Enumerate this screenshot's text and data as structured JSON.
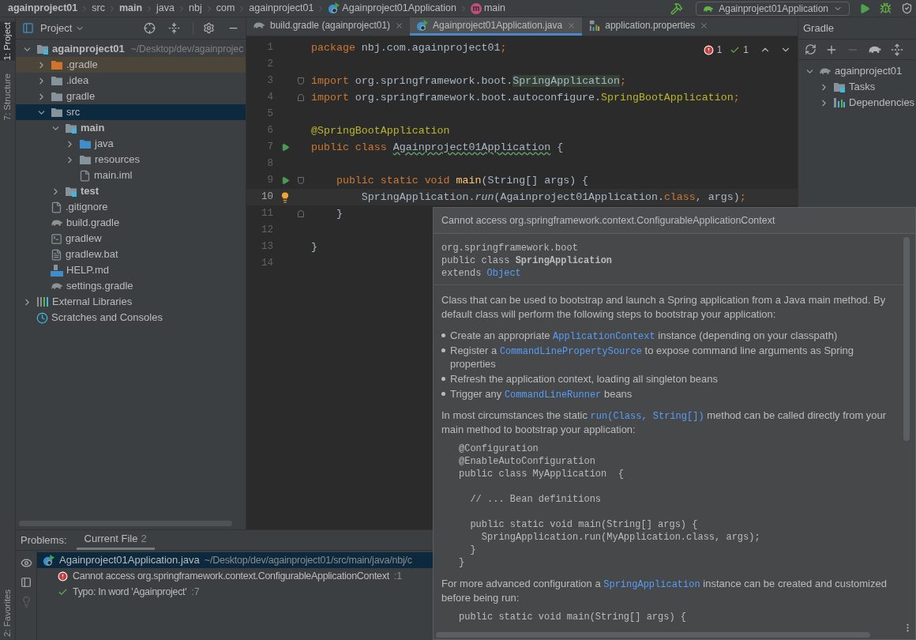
{
  "breadcrumbs": [
    {
      "label": "againproject01",
      "kind": "project"
    },
    {
      "label": "src",
      "kind": "folder"
    },
    {
      "label": "main",
      "kind": "module"
    },
    {
      "label": "java",
      "kind": "folder"
    },
    {
      "label": "nbj",
      "kind": "folder"
    },
    {
      "label": "com",
      "kind": "folder"
    },
    {
      "label": "againproject01",
      "kind": "folder"
    },
    {
      "label": "Againproject01Application",
      "kind": "class"
    },
    {
      "label": "main",
      "kind": "method",
      "badge": "m"
    }
  ],
  "run_config": {
    "label": "Againproject01Application"
  },
  "left_stripe": [
    {
      "label": "1: Project",
      "selected": true
    },
    {
      "label": "7: Structure",
      "selected": false
    }
  ],
  "bottom_stripe": {
    "label": "2: Favorites"
  },
  "project_panel": {
    "title": "Project",
    "tree": [
      {
        "label": "againproject01",
        "hint": "~/Desktop/dev/againprojec",
        "kind": "module",
        "selected": false,
        "expanded": true,
        "children": [
          {
            "label": ".gradle",
            "kind": "excluded",
            "selected": false,
            "expanded": false
          },
          {
            "label": ".idea",
            "kind": "folder",
            "selected": false,
            "expanded": false
          },
          {
            "label": "gradle",
            "kind": "folder",
            "selected": false,
            "expanded": false
          },
          {
            "label": "src",
            "kind": "folder",
            "selected": true,
            "expanded": true,
            "children": [
              {
                "label": "main",
                "kind": "module",
                "selected": false,
                "expanded": true,
                "children": [
                  {
                    "label": "java",
                    "kind": "source",
                    "selected": false,
                    "expanded": false
                  },
                  {
                    "label": "resources",
                    "kind": "folder",
                    "selected": false,
                    "expanded": false
                  },
                  {
                    "label": "main.iml",
                    "kind": "iml",
                    "selected": false
                  }
                ]
              },
              {
                "label": "test",
                "kind": "module",
                "selected": false,
                "expanded": false
              }
            ]
          },
          {
            "label": ".gitignore",
            "kind": "ignore",
            "selected": false
          },
          {
            "label": "build.gradle",
            "kind": "gradle",
            "selected": false
          },
          {
            "label": "gradlew",
            "kind": "script",
            "selected": false
          },
          {
            "label": "gradlew.bat",
            "kind": "text",
            "selected": false
          },
          {
            "label": "HELP.md",
            "kind": "markdown",
            "selected": false
          },
          {
            "label": "settings.gradle",
            "kind": "gradle",
            "selected": false
          }
        ]
      },
      {
        "label": "External Libraries",
        "kind": "libraries",
        "selected": false,
        "expanded": false
      },
      {
        "label": "Scratches and Consoles",
        "kind": "scratches",
        "selected": false
      }
    ]
  },
  "editor": {
    "tabs": [
      {
        "label": "build.gradle (againproject01)",
        "kind": "gradle",
        "selected": false
      },
      {
        "label": "Againproject01Application.java",
        "kind": "class",
        "selected": true
      },
      {
        "label": "application.properties",
        "kind": "properties",
        "selected": false
      }
    ],
    "inspections": {
      "errors": "1",
      "typos": "1"
    },
    "lines": [
      {
        "number": "1",
        "current": false,
        "tokens": [
          {
            "text": "package ",
            "kind": "kw"
          },
          {
            "text": "nbj.com.againproject01",
            "kind": "plain"
          },
          {
            "text": ";",
            "kind": "kw"
          }
        ]
      },
      {
        "number": "2",
        "current": false
      },
      {
        "number": "3",
        "current": false,
        "fold_start": true,
        "tokens": [
          {
            "text": "import ",
            "kind": "kw"
          },
          {
            "text": "org.springframework.boot.",
            "kind": "plain"
          },
          {
            "text": "SpringApplication",
            "kind": "ref"
          },
          {
            "text": ";",
            "kind": "kw"
          }
        ]
      },
      {
        "number": "4",
        "current": false,
        "fold_end": true,
        "tokens": [
          {
            "text": "import ",
            "kind": "kw"
          },
          {
            "text": "org.springframework.boot.autoconfigure.",
            "kind": "plain"
          },
          {
            "text": "SpringBootApplication",
            "kind": "anno"
          },
          {
            "text": ";",
            "kind": "kw"
          }
        ]
      },
      {
        "number": "5",
        "current": false
      },
      {
        "number": "6",
        "current": false,
        "tokens": [
          {
            "text": "@SpringBootApplication",
            "kind": "anno"
          }
        ]
      },
      {
        "number": "7",
        "current": false,
        "run": true,
        "tokens": [
          {
            "text": "public class ",
            "kind": "kw"
          },
          {
            "text": "Againproject01Application",
            "kind": "typo"
          },
          {
            "text": " {",
            "kind": "plain"
          }
        ]
      },
      {
        "number": "8",
        "current": false
      },
      {
        "number": "9",
        "current": false,
        "run": true,
        "fold_start": true,
        "tokens": [
          {
            "text": "    public static void ",
            "kind": "kw"
          },
          {
            "text": "main",
            "kind": "method"
          },
          {
            "text": "(String[] args) {",
            "kind": "plain"
          }
        ]
      },
      {
        "number": "10",
        "current": true,
        "bulb": true,
        "tokens": [
          {
            "text": "        SpringApplication.",
            "kind": "plain"
          },
          {
            "text": "run",
            "kind": "call"
          },
          {
            "text": "(Againproject01Application.",
            "kind": "plain"
          },
          {
            "text": "class",
            "kind": "kw"
          },
          {
            "text": ", args)",
            "kind": "plain"
          },
          {
            "text": ";",
            "kind": "kw"
          }
        ]
      },
      {
        "number": "11",
        "current": false,
        "fold_end": true,
        "tokens": [
          {
            "text": "    }",
            "kind": "plain"
          }
        ]
      },
      {
        "number": "12",
        "current": false
      },
      {
        "number": "13",
        "current": false,
        "tokens": [
          {
            "text": "}",
            "kind": "plain"
          }
        ]
      },
      {
        "number": "14",
        "current": false
      }
    ]
  },
  "gradle_panel": {
    "title": "Gradle",
    "toolbar": [
      {
        "kind": "refresh",
        "disabled": false
      },
      {
        "kind": "add",
        "disabled": false
      },
      {
        "kind": "remove",
        "disabled": true
      },
      {
        "kind": "elephant",
        "disabled": false
      },
      {
        "kind": "expand",
        "disabled": false
      }
    ],
    "tree": [
      {
        "label": "againproject01",
        "kind": "project",
        "expanded": true,
        "children": [
          {
            "label": "Tasks",
            "kind": "tasks",
            "expanded": false
          },
          {
            "label": "Dependencies",
            "kind": "dependencies",
            "expanded": false
          }
        ]
      }
    ]
  },
  "problems": {
    "label": "Problems:",
    "tabs": [
      {
        "label": "Current File",
        "count": "2",
        "selected": true
      }
    ],
    "tools": [
      {
        "kind": "eye",
        "disabled": false
      },
      {
        "kind": "preview",
        "disabled": false
      },
      {
        "kind": "bulb",
        "disabled": true
      }
    ],
    "file": {
      "name": "Againproject01Application.java",
      "path": "~/Desktop/dev/againproject01/src/main/java/nbj/c",
      "selected": true
    },
    "items": [
      {
        "kind": "error",
        "text": "Cannot access org.springframework.context.ConfigurableApplicationContext",
        "line": ":1"
      },
      {
        "kind": "typo",
        "text": "Typo: In word 'Againproject'",
        "line": ":7"
      }
    ]
  },
  "popup": {
    "title": "Cannot access org.springframework.context.ConfigurableApplicationContext",
    "signature": [
      [
        {
          "text": "org.springframework.boot",
          "kind": "text"
        }
      ],
      [
        {
          "text": "public class ",
          "kind": "text"
        },
        {
          "text": "SpringApplication",
          "kind": "bold"
        }
      ],
      [
        {
          "text": "extends ",
          "kind": "text"
        },
        {
          "text": "Object",
          "kind": "link"
        }
      ]
    ],
    "blocks": [
      {
        "kind": "paragraph",
        "parts": [
          {
            "text": "Class that can be used to bootstrap and launch a Spring application from a Java main method. By default class will perform the following steps to bootstrap your application:",
            "kind": "text"
          }
        ]
      },
      {
        "kind": "bullets",
        "items": [
          [
            {
              "text": "Create an appropriate ",
              "kind": "text"
            },
            {
              "text": "ApplicationContext",
              "kind": "link"
            },
            {
              "text": " instance (depending on your classpath)",
              "kind": "text"
            }
          ],
          [
            {
              "text": "Register a ",
              "kind": "text"
            },
            {
              "text": "CommandLinePropertySource",
              "kind": "link"
            },
            {
              "text": " to expose command line arguments as Spring properties",
              "kind": "text"
            }
          ],
          [
            {
              "text": "Refresh the application context, loading all singleton beans",
              "kind": "text"
            }
          ],
          [
            {
              "text": "Trigger any ",
              "kind": "text"
            },
            {
              "text": "CommandLineRunner",
              "kind": "link"
            },
            {
              "text": " beans",
              "kind": "text"
            }
          ]
        ]
      },
      {
        "kind": "paragraph",
        "parts": [
          {
            "text": "In most circumstances the static ",
            "kind": "text"
          },
          {
            "text": "run(Class, String[])",
            "kind": "link"
          },
          {
            "text": " method can be called directly from your main method to bootstrap your application:",
            "kind": "text"
          }
        ]
      },
      {
        "kind": "code",
        "groups": [
          [
            "@Configuration",
            "@EnableAutoConfiguration",
            "public class MyApplication  {"
          ],
          [
            "  // ... Bean definitions"
          ],
          [
            "  public static void main(String[] args) {",
            "    SpringApplication.run(MyApplication.class, args);",
            "  }",
            "}"
          ]
        ]
      },
      {
        "kind": "paragraph",
        "parts": [
          {
            "text": "For more advanced configuration a ",
            "kind": "text"
          },
          {
            "text": "SpringApplication",
            "kind": "link"
          },
          {
            "text": " instance can be created and customized before being run:",
            "kind": "text"
          }
        ]
      },
      {
        "kind": "code",
        "groups": [
          [
            "public static void main(String[] args) {"
          ]
        ]
      }
    ]
  }
}
